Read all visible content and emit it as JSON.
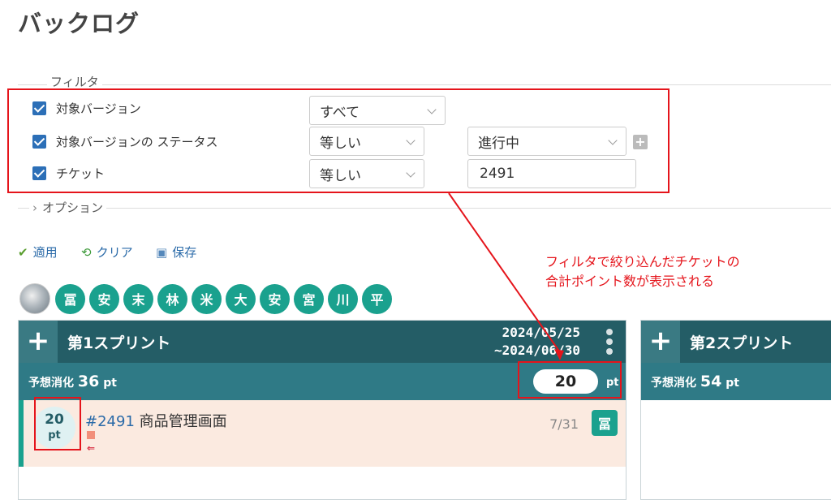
{
  "page": {
    "title": "バックログ"
  },
  "filters": {
    "legend": "フィルタ",
    "rows": [
      {
        "label": "対象バージョン",
        "operator": "すべて"
      },
      {
        "label": "対象バージョンの ステータス",
        "operator": "等しい",
        "value": "進行中"
      },
      {
        "label": "チケット",
        "operator": "等しい",
        "value": "2491"
      }
    ],
    "add_icon": "plus-icon"
  },
  "options": {
    "legend": "オプション"
  },
  "actions": {
    "apply": "適用",
    "clear": "クリア",
    "save": "保存"
  },
  "annotation": {
    "line1": "フィルタで絞り込んだチケットの",
    "line2": "合計ポイント数が表示される"
  },
  "members": [
    "冨",
    "安",
    "末",
    "林",
    "米",
    "大",
    "安",
    "宮",
    "川",
    "平"
  ],
  "sprints": [
    {
      "name": "第1スプリント",
      "date_start": "2024/05/25",
      "date_end": "~2024/06/30",
      "estimate_label": "予想消化",
      "estimate_value": "36",
      "unit": "pt",
      "filtered_points": "20",
      "ticket": {
        "points": "20",
        "points_unit": "pt",
        "number": "#2491",
        "title": "商品管理画面",
        "date": "7/31",
        "assignee": "冨"
      }
    },
    {
      "name": "第2スプリント",
      "estimate_label": "予想消化",
      "estimate_value": "54",
      "unit": "pt"
    }
  ],
  "colors": {
    "accent_red": "#e5141b",
    "sprint_header": "#245d66",
    "sprint_sub": "#2f7a86",
    "member_green": "#1aa18e",
    "link_blue": "#2a6aa8"
  }
}
